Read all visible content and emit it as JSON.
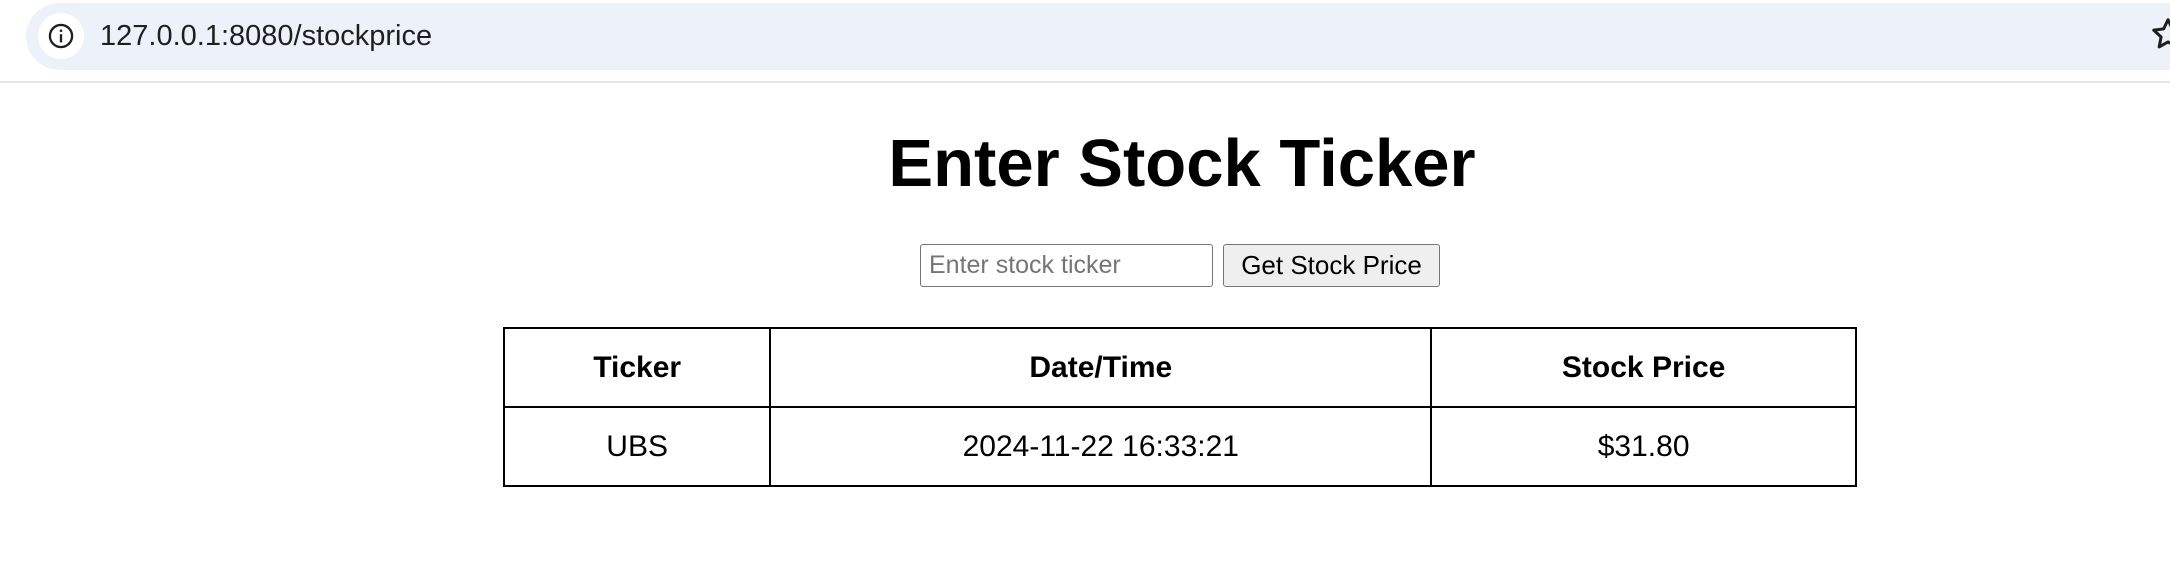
{
  "browser": {
    "url": "127.0.0.1:8080/stockprice"
  },
  "page": {
    "title": "Enter Stock Ticker"
  },
  "form": {
    "input_placeholder": "Enter stock ticker",
    "input_value": "",
    "button_label": "Get Stock Price"
  },
  "table": {
    "headers": [
      "Ticker",
      "Date/Time",
      "Stock Price"
    ],
    "rows": [
      [
        "UBS",
        "2024-11-22 16:33:21",
        "$31.80"
      ]
    ]
  },
  "icons": {
    "site_info": "info-icon",
    "bookmark": "star-icon"
  }
}
